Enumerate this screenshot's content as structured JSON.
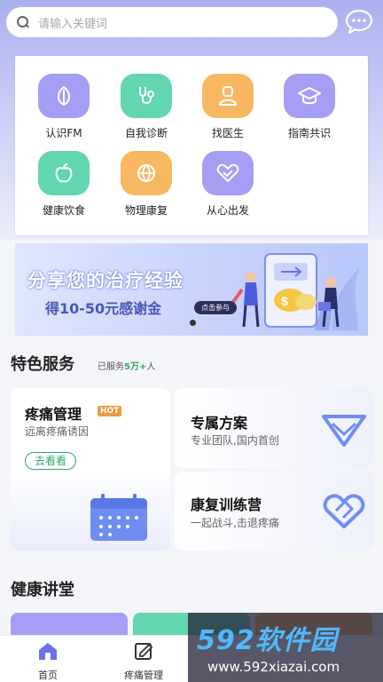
{
  "search": {
    "placeholder": "请输入关键词"
  },
  "icons": {
    "chat": "chat-bubble-icon",
    "search": "search-icon"
  },
  "grid": [
    {
      "label": "认识FM",
      "icon": "leaf-icon",
      "color": "#9e97f2"
    },
    {
      "label": "自我诊断",
      "icon": "stethoscope-icon",
      "color": "#5fd3a9"
    },
    {
      "label": "找医生",
      "icon": "doctor-icon",
      "color": "#f8b45c"
    },
    {
      "label": "指南共识",
      "icon": "graduation-cap-icon",
      "color": "#9e97f2"
    },
    {
      "label": "健康饮食",
      "icon": "apple-icon",
      "color": "#5fd3a9"
    },
    {
      "label": "物理康复",
      "icon": "ball-icon",
      "color": "#f8b45c"
    },
    {
      "label": "从心出发",
      "icon": "heart-icon",
      "color": "#9e97f2"
    }
  ],
  "banner": {
    "title": "分享您的治疗经验",
    "subtitle": "得10-50元感谢金",
    "button": "点击参与"
  },
  "featured": {
    "title": "特色服务",
    "served_prefix": "已服务",
    "served_count": "5万+",
    "served_suffix": "人",
    "cards": {
      "pain": {
        "title": "疼痛管理",
        "badge": "HOT",
        "subtitle": "远离疼痛诱因",
        "button": "去看看"
      },
      "plan": {
        "title": "专属方案",
        "subtitle": "专业团队,国内首创"
      },
      "camp": {
        "title": "康复训练营",
        "subtitle": "一起战斗,击退疼痛"
      }
    }
  },
  "lecture": {
    "title": "健康讲堂"
  },
  "tabbar": [
    {
      "label": "首页",
      "icon": "home-icon",
      "active": true
    },
    {
      "label": "疼痛管理",
      "icon": "edit-icon",
      "active": false
    }
  ],
  "watermark": {
    "brand": "592软件园",
    "url": "www.592xiazai.com"
  },
  "colors": {
    "accent": "#2fa86a",
    "primary": "#6c73e8",
    "hot": "#f19a3e"
  }
}
